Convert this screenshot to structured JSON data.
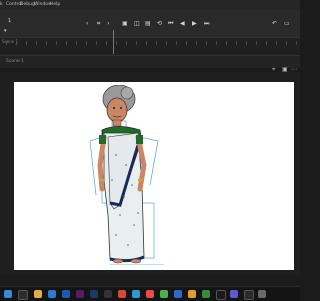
{
  "menu": {
    "items": [
      "k",
      "Control",
      "Debug",
      "Window",
      "Help"
    ]
  },
  "toolbar": {
    "frame_number": "1",
    "icons": [
      "chevron-left-icon",
      "camera-icon",
      "chevron-right-icon",
      "onion-skin-icon",
      "edit-multiple-icon",
      "frame-icon",
      "loop-icon",
      "step-back-icon",
      "play-icon",
      "step-forward-icon",
      "undo-icon",
      "redo-icon"
    ]
  },
  "scene": {
    "label": "Scene 1"
  },
  "timeline": {
    "label": "Scene 1"
  },
  "colors": {
    "saree_base": "#e9eef0",
    "saree_border": "#1a2a5a",
    "blouse": "#1f6b2a",
    "skin": "#c9876a",
    "hair": "#9a9a9a",
    "bones": "#5aa0d8"
  },
  "taskbar": {
    "apps": [
      "start-icon",
      "search-icon",
      "files-icon",
      "browser-icon",
      "mail-icon",
      "animate-icon",
      "photoshop-icon",
      "media-icon",
      "chrome-icon",
      "edge-icon",
      "store-icon",
      "settings-icon",
      "terminal-icon",
      "folder-icon",
      "app-icon",
      "music-icon",
      "chat-icon",
      "calendar-icon",
      "extra-icon"
    ]
  }
}
